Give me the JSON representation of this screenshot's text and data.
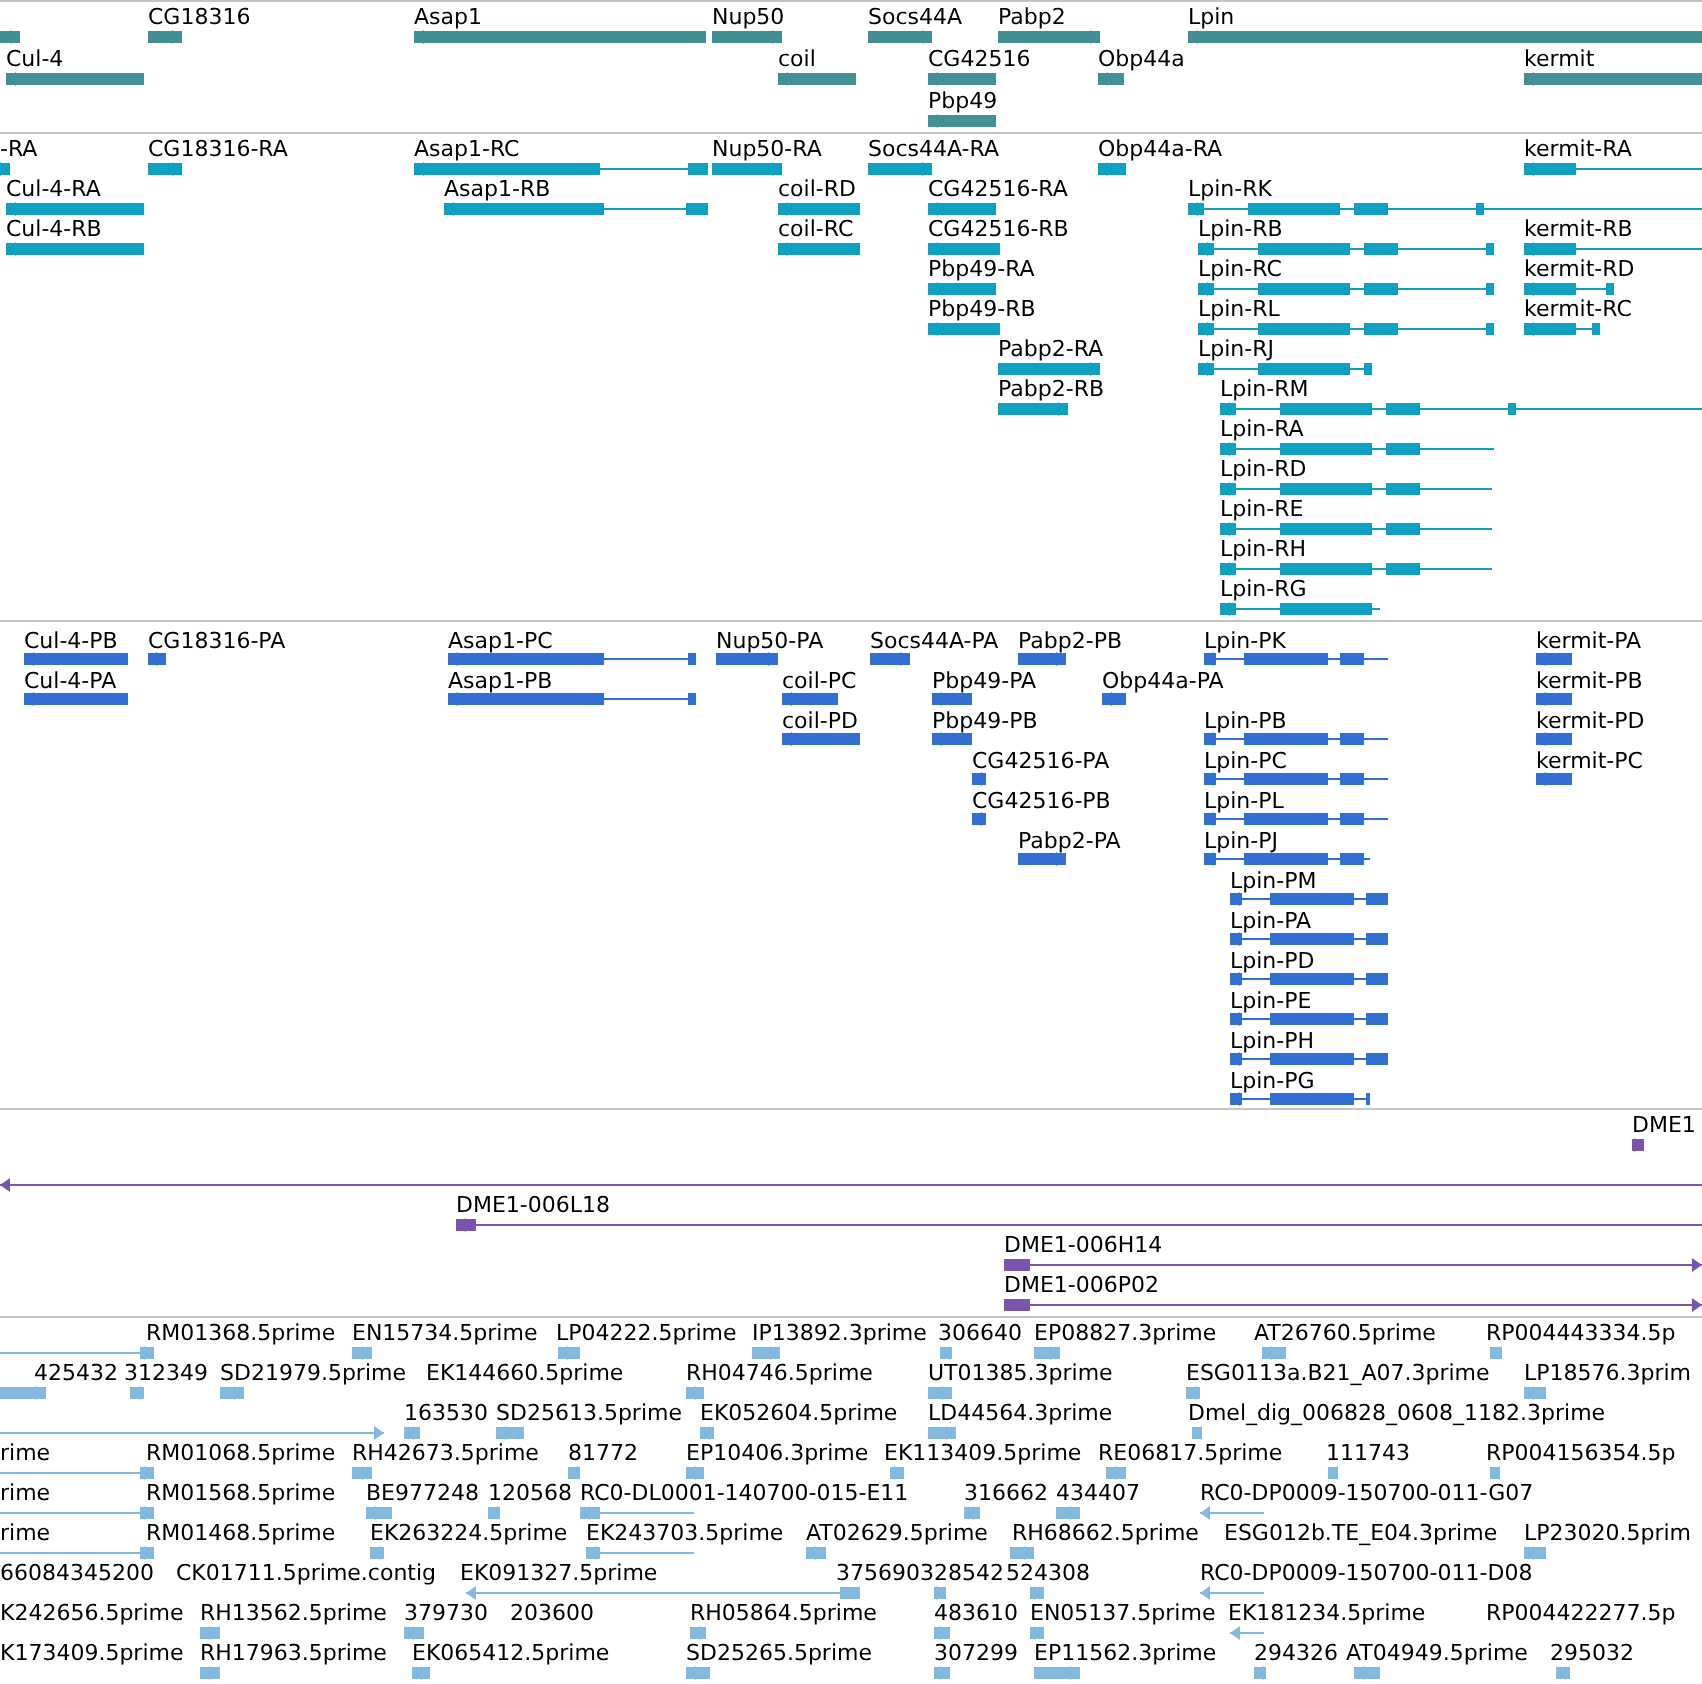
{
  "tracks": [
    {
      "kind": "gene",
      "features": [
        {
          "reverse": false
        },
        {
          "label": "CG18316",
          "reverse": false
        },
        {
          "label": "Asap1",
          "reverse": true
        },
        {
          "label": "Nup50",
          "reverse": false
        },
        {
          "label": "Socs44A",
          "reverse": false
        },
        {
          "label": "Pabp2",
          "reverse": false
        },
        {
          "label": "Lpin",
          "reverse": true
        },
        {
          "label": "Cul-4",
          "reverse": true
        },
        {
          "label": "coil",
          "reverse": true
        },
        {
          "label": "CG42516",
          "reverse": true
        },
        {
          "label": "Obp44a",
          "reverse": true
        },
        {
          "label": "kermit",
          "reverse": true
        },
        {
          "label": "Pbp49",
          "reverse": true
        }
      ]
    },
    {
      "kind": "transcript",
      "features": [
        {
          "label": "-RA",
          "reverse": false
        },
        {
          "label": "CG18316-RA",
          "reverse": false
        },
        {
          "label": "Asap1-RC",
          "reverse": true
        },
        {
          "label": "Nup50-RA",
          "reverse": false
        },
        {
          "label": "Socs44A-RA",
          "reverse": false
        },
        {
          "label": "Obp44a-RA",
          "reverse": true
        },
        {
          "label": "kermit-RA",
          "reverse": true
        },
        {
          "label": "Cul-4-RA",
          "reverse": true
        },
        {
          "label": "Asap1-RB",
          "reverse": true
        },
        {
          "label": "coil-RD",
          "reverse": true
        },
        {
          "label": "CG42516-RA",
          "reverse": true
        },
        {
          "label": "Lpin-RK",
          "reverse": true
        },
        {
          "label": "Cul-4-RB",
          "reverse": true
        },
        {
          "label": "coil-RC",
          "reverse": true
        },
        {
          "label": "CG42516-RB",
          "reverse": true
        },
        {
          "label": "Lpin-RB",
          "reverse": true
        },
        {
          "label": "kermit-RB",
          "reverse": true
        },
        {
          "label": "Pbp49-RA",
          "reverse": true
        },
        {
          "label": "Lpin-RC",
          "reverse": true
        },
        {
          "label": "kermit-RD",
          "reverse": true
        },
        {
          "label": "Pbp49-RB",
          "reverse": true
        },
        {
          "label": "Lpin-RL",
          "reverse": true
        },
        {
          "label": "kermit-RC",
          "reverse": true
        },
        {
          "label": "Pabp2-RA",
          "reverse": false
        },
        {
          "label": "Lpin-RJ",
          "reverse": true
        },
        {
          "label": "Pabp2-RB",
          "reverse": false
        },
        {
          "label": "Lpin-RM",
          "reverse": true
        },
        {
          "label": "Lpin-RA",
          "reverse": true
        },
        {
          "label": "Lpin-RD",
          "reverse": true
        },
        {
          "label": "Lpin-RE",
          "reverse": true
        },
        {
          "label": "Lpin-RH",
          "reverse": true
        },
        {
          "label": "Lpin-RG",
          "reverse": true
        }
      ]
    },
    {
      "kind": "protein",
      "features": [
        {
          "label": "Cul-4-PB",
          "reverse": true
        },
        {
          "label": "CG18316-PA",
          "reverse": false
        },
        {
          "label": "Asap1-PC",
          "reverse": true
        },
        {
          "label": "Nup50-PA",
          "reverse": false
        },
        {
          "label": "Socs44A-PA",
          "reverse": false
        },
        {
          "label": "Pabp2-PB",
          "reverse": false
        },
        {
          "label": "Lpin-PK",
          "reverse": true
        },
        {
          "label": "kermit-PA",
          "reverse": true
        },
        {
          "label": "Cul-4-PA",
          "reverse": true
        },
        {
          "label": "Asap1-PB",
          "reverse": true
        },
        {
          "label": "coil-PC",
          "reverse": true
        },
        {
          "label": "Pbp49-PA",
          "reverse": true
        },
        {
          "label": "Obp44a-PA",
          "reverse": true
        },
        {
          "label": "kermit-PB",
          "reverse": true
        },
        {
          "label": "coil-PD",
          "reverse": true
        },
        {
          "label": "Pbp49-PB",
          "reverse": true
        },
        {
          "label": "Lpin-PB",
          "reverse": true
        },
        {
          "label": "kermit-PD",
          "reverse": true
        },
        {
          "label": "CG42516-PA",
          "reverse": true
        },
        {
          "label": "Lpin-PC",
          "reverse": true
        },
        {
          "label": "kermit-PC",
          "reverse": true
        },
        {
          "label": "CG42516-PB",
          "reverse": true
        },
        {
          "label": "Lpin-PL",
          "reverse": true
        },
        {
          "label": "Pabp2-PA",
          "reverse": false
        },
        {
          "label": "Lpin-PJ",
          "reverse": true
        },
        {
          "label": "Lpin-PM",
          "reverse": true
        },
        {
          "label": "Lpin-PA",
          "reverse": true
        },
        {
          "label": "Lpin-PD",
          "reverse": true
        },
        {
          "label": "Lpin-PE",
          "reverse": true
        },
        {
          "label": "Lpin-PH",
          "reverse": true
        },
        {
          "label": "Lpin-PG",
          "reverse": true
        }
      ]
    },
    {
      "kind": "clone",
      "features": [
        {
          "label": "DME1",
          "reverse": false
        },
        {
          "reverse": true
        },
        {
          "label": "DME1-006L18",
          "reverse": true
        },
        {
          "label": "DME1-006H14",
          "reverse": false
        },
        {
          "label": "DME1-006P02",
          "reverse": false
        }
      ]
    },
    {
      "kind": "est",
      "features": [
        {
          "label": "RM01368.5prime",
          "reverse": false
        },
        {
          "label": "EN15734.5prime",
          "reverse": false
        },
        {
          "label": "LP04222.5prime",
          "reverse": true
        },
        {
          "label": "IP13892.3prime",
          "reverse": false
        },
        {
          "label": "306640",
          "reverse": true
        },
        {
          "label": "EP08827.3prime",
          "reverse": false
        },
        {
          "label": "AT26760.5prime",
          "reverse": true
        },
        {
          "label": "RP004443334.5p",
          "reverse": true
        },
        {
          "label": "425432",
          "reverse": false
        },
        {
          "label": "312349",
          "reverse": true
        },
        {
          "label": "SD21979.5prime",
          "reverse": false
        },
        {
          "label": "EK144660.5prime"
        },
        {
          "label": "RH04746.5prime",
          "reverse": true
        },
        {
          "label": "UT01385.3prime",
          "reverse": false
        },
        {
          "label": "ESG0113a.B21_A07.3prime",
          "reverse": true
        },
        {
          "label": "LP18576.3prim",
          "reverse": true
        },
        {
          "reverse": false
        },
        {
          "label": "163530",
          "reverse": true
        },
        {
          "label": "SD25613.5prime",
          "reverse": true
        },
        {
          "label": "EK052604.5prime",
          "reverse": true
        },
        {
          "label": "LD44564.3prime",
          "reverse": false
        },
        {
          "label": "Dmel_dig_006828_0608_1182.3prime",
          "reverse": true
        },
        {
          "label": "rime"
        },
        {
          "label": "RM01068.5prime",
          "reverse": false
        },
        {
          "label": "RH42673.5prime",
          "reverse": false
        },
        {
          "label": "81772",
          "reverse": true
        },
        {
          "label": "EP10406.3prime",
          "reverse": true
        },
        {
          "label": "EK113409.5prime",
          "reverse": false
        },
        {
          "label": "RE06817.5prime",
          "reverse": true
        },
        {
          "label": "111743",
          "reverse": true
        },
        {
          "label": "RP004156354.5p",
          "reverse": true
        },
        {
          "label": "rime"
        },
        {
          "label": "RM01568.5prime",
          "reverse": false
        },
        {
          "label": "BE977248",
          "reverse": true
        },
        {
          "label": "120568",
          "reverse": true
        },
        {
          "label": "RC0-DL0001-140700-015-E11",
          "reverse": true
        },
        {
          "label": "316662",
          "reverse": true
        },
        {
          "label": "434407",
          "reverse": false
        },
        {
          "label": "RC0-DP0009-150700-011-G07",
          "reverse": true
        },
        {
          "label": "rime"
        },
        {
          "label": "RM01468.5prime",
          "reverse": false
        },
        {
          "label": "EK263224.5prime",
          "reverse": true
        },
        {
          "label": "EK243703.5prime",
          "reverse": true
        },
        {
          "label": "AT02629.5prime",
          "reverse": true
        },
        {
          "label": "RH68662.5prime",
          "reverse": false
        },
        {
          "label": "ESG012b.TE_E04.3prime"
        },
        {
          "label": "LP23020.5prim",
          "reverse": true
        },
        {
          "label": "66084345200"
        },
        {
          "label": "CK01711.5prime.contig"
        },
        {
          "label": "EK091327.5prime",
          "reverse": true
        },
        {
          "label": "375690"
        },
        {
          "label": "328542",
          "reverse": false
        },
        {
          "label": "524308",
          "reverse": false
        },
        {
          "label": "RC0-DP0009-150700-011-D08",
          "reverse": true
        },
        {
          "label": "K242656.5prime"
        },
        {
          "label": "RH13562.5prime",
          "reverse": true
        },
        {
          "label": "379730",
          "reverse": true
        },
        {
          "label": "203600"
        },
        {
          "label": "RH05864.5prime",
          "reverse": true
        },
        {
          "label": "483610",
          "reverse": false
        },
        {
          "label": "EN05137.5prime",
          "reverse": false
        },
        {
          "label": "EK181234.5prime",
          "reverse": true
        },
        {
          "label": "RP004422277.5p"
        },
        {
          "label": "K173409.5prime"
        },
        {
          "label": "RH17963.5prime",
          "reverse": true
        },
        {
          "label": "EK065412.5prime",
          "reverse": true
        },
        {
          "label": "SD25265.5prime",
          "reverse": true
        },
        {
          "label": "307299",
          "reverse": false
        },
        {
          "label": "EP11562.3prime",
          "reverse": false
        },
        {
          "label": "294326",
          "reverse": true
        },
        {
          "label": "AT04949.5prime",
          "reverse": true
        },
        {
          "label": "295032",
          "reverse": true
        }
      ]
    }
  ]
}
